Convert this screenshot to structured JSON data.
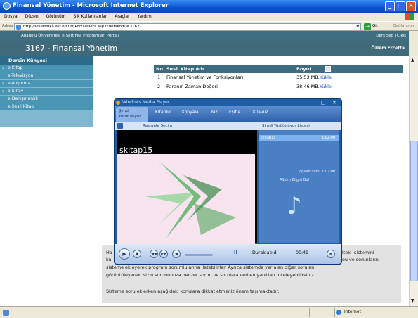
{
  "window": {
    "title": "Finansal Yönetim - Microsoft Internet Explorer"
  },
  "menu": [
    "Dosya",
    "Düzen",
    "Görünüm",
    "Sık Kullanılanlar",
    "Araçlar",
    "Yardım"
  ],
  "address": {
    "label": "Adres",
    "url": "http://lesertifika.asf.edu.tr/Portal/Ders.aspx?derskodu=3167",
    "go": "Git",
    "links": "Bağlantılar"
  },
  "portal": {
    "left": "Anadolu Üniversitesi e-Sertifika Programları Portalı",
    "right": "Ders Seç | Çıkış"
  },
  "site": {
    "course": "3167 - Finansal Yönetim",
    "user": "Özlem Ercetta"
  },
  "sidebar": {
    "title": "Dersin Künyesi",
    "items": [
      {
        "label": "e-Kitap",
        "arrow": true
      },
      {
        "label": "e-Televizyon",
        "arrow": false
      },
      {
        "label": "e-Alıştırma",
        "arrow": true
      },
      {
        "label": "e-Sınav",
        "arrow": true
      },
      {
        "label": "e-Danışmanlık",
        "arrow": false
      },
      {
        "label": "e-Sesli Kitap",
        "arrow": false
      }
    ]
  },
  "table": {
    "headers": [
      "No",
      "Sesli Kitap Adı",
      "Boyut"
    ],
    "rows": [
      {
        "no": "1",
        "name": "Finansal Yönetim ve Fonksiyonları",
        "size": "35,53 MB.",
        "action": "Yükle"
      },
      {
        "no": "2",
        "name": "Paranın Zaman Değeri",
        "size": "38,46 MB.",
        "action": "Yükle"
      }
    ]
  },
  "text": {
    "line1_start": "Ha",
    "line1_link": "ltek",
    "line1_end": "sistemini",
    "line2_start": "ku",
    "line2_end": "ou ve sorunlarını",
    "line3": "sisteme ekleyerek program sorumlularına iletebilirler. Ayrıca sistemde yer alan diğer sorulan",
    "line4": "görüntüleyerek, sizin sorununuza benzer sorun ve sorulara verilen yanıtları inceleyebilirsiniz.",
    "line5": "Sisteme soru eklerken aşağıdaki konulara dikkat etmeniz önem taşımaktadır."
  },
  "wmp": {
    "title": "Windows Media Player",
    "tabs": [
      "Şimdi Yürütülüyor",
      "Kitaplık",
      "Kopyala",
      "Yaz",
      "Eşitle",
      "Kılavuz"
    ],
    "toolbar": "Rastgele Seçim",
    "playlist_label": "Şimdi Yürütülüyor Listesi",
    "track": "skitap15",
    "track_time": "1:02:00",
    "total": "Toplam Süre: 1:02:00",
    "album": "Albüm Bilgisi Bul",
    "video_title": "skitap15",
    "status": "Duraklatıldı",
    "elapsed": "00:49"
  },
  "statusbar": {
    "zone": "Internet"
  }
}
